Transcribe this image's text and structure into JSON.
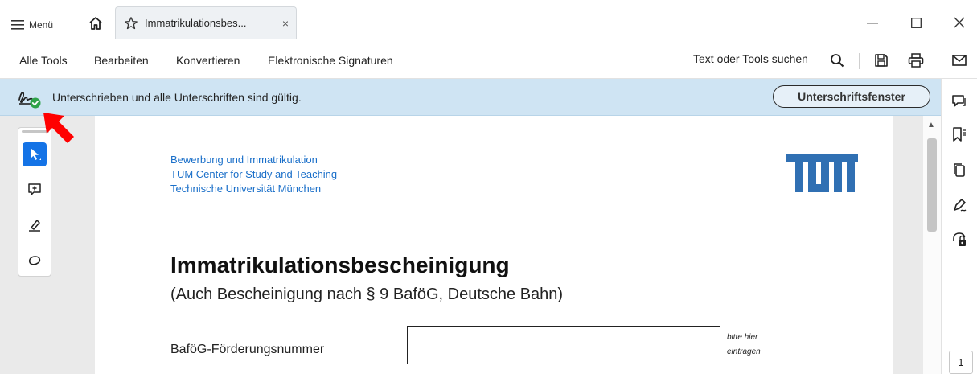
{
  "titlebar": {
    "menu_label": "Menü",
    "tab_label": "Immatrikulationsbes...",
    "tab_close": "×"
  },
  "toolbar": {
    "items": [
      "Alle Tools",
      "Bearbeiten",
      "Konvertieren",
      "Elektronische Signaturen"
    ],
    "search_label": "Text oder Tools suchen"
  },
  "signature_banner": {
    "text": "Unterschrieben und alle Unterschriften sind gültig.",
    "button_label": "Unterschriftsfenster"
  },
  "document": {
    "header_lines": [
      "Bewerbung und Immatrikulation",
      "TUM Center for Study and Teaching",
      "Technische Universität München"
    ],
    "title": "Immatrikulationsbescheinigung",
    "subtitle": "(Auch Bescheinigung nach § 9 BaföG, Deutsche Bahn)",
    "field_label": "BaföG-Förderungsnummer",
    "field_value": "",
    "field_hint_lines": [
      "bitte hier",
      "eintragen"
    ]
  },
  "page_indicator": "1",
  "colors": {
    "accent_blue": "#1473e6",
    "banner_bg": "#cfe4f3",
    "tum_blue": "#3070b3",
    "link_blue": "#1a6fc9",
    "annotation_red": "#ff0000",
    "valid_green": "#2fa34a"
  },
  "icons": {
    "menu": "hamburger-icon",
    "home": "home-icon",
    "tab_star": "star-icon",
    "search": "search-icon",
    "save": "save-icon",
    "print": "print-icon",
    "mail": "mail-icon",
    "signature_valid": "signature-valid-icon",
    "right_rail": [
      "comment-icon",
      "bookmark-icon",
      "pages-icon",
      "fill-sign-icon",
      "protect-icon"
    ],
    "left_tools": [
      "select-cursor-icon",
      "add-comment-icon",
      "highlight-pen-icon",
      "lasso-icon"
    ]
  }
}
